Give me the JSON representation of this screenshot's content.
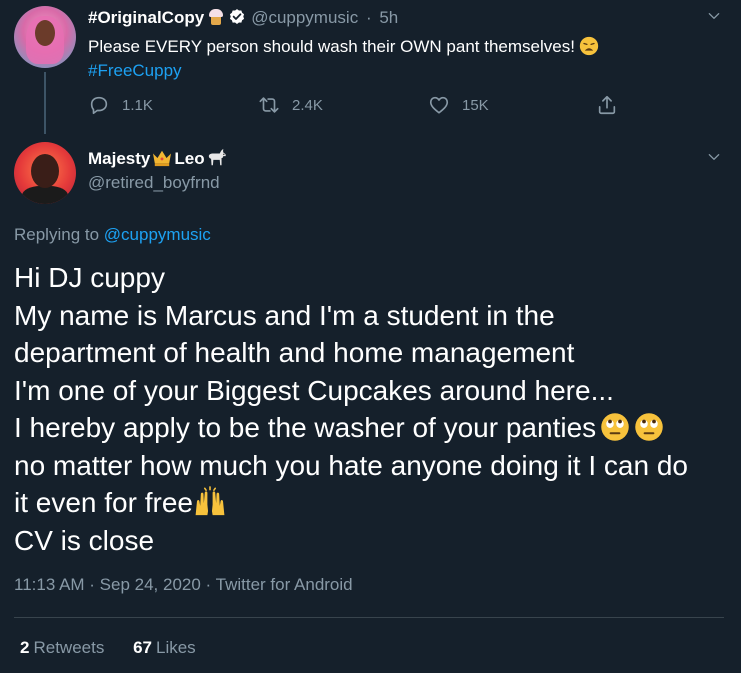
{
  "parent_tweet": {
    "display_name": "#OriginalCopy",
    "handle": "@cuppymusic",
    "separator": "·",
    "time_ago": "5h",
    "text": "Please EVERY person should wash their OWN pant themselves!",
    "hashtag": "#FreeCuppy",
    "replies": "1.1K",
    "retweets": "2.4K",
    "likes": "15K",
    "icons": [
      "cupcake-icon",
      "verified-icon",
      "weary-face-emoji",
      "reply-icon",
      "retweet-icon",
      "like-icon",
      "share-icon",
      "chevron-down-icon"
    ]
  },
  "tweet": {
    "name_part1": "Majesty",
    "name_part2": "Leo",
    "handle": "@retired_boyfrnd",
    "replying_prefix": "Replying to",
    "replying_to": "@cuppymusic",
    "lines": [
      "Hi DJ cuppy",
      "My name is Marcus and I'm a student in the",
      "department of health and home management",
      "I'm one of your Biggest Cupcakes around here...",
      "I hereby apply to be the washer of your panties",
      "no matter how much you hate anyone doing it I can do",
      "it even for free",
      "CV is close"
    ],
    "timestamp": "11:13 AM · Sep 24, 2020 · Twitter for Android",
    "retweet_count": "2",
    "retweet_label": "Retweets",
    "like_count": "67",
    "like_label": "Likes",
    "icons": [
      "crown-icon",
      "goat-icon",
      "rolling-eyes-emoji",
      "raising-hands-emoji",
      "chevron-down-icon"
    ]
  },
  "colors": {
    "background": "#15202b",
    "text": "#ffffff",
    "secondary": "#8899a6",
    "link": "#1da1f2",
    "divider": "#38444d"
  }
}
